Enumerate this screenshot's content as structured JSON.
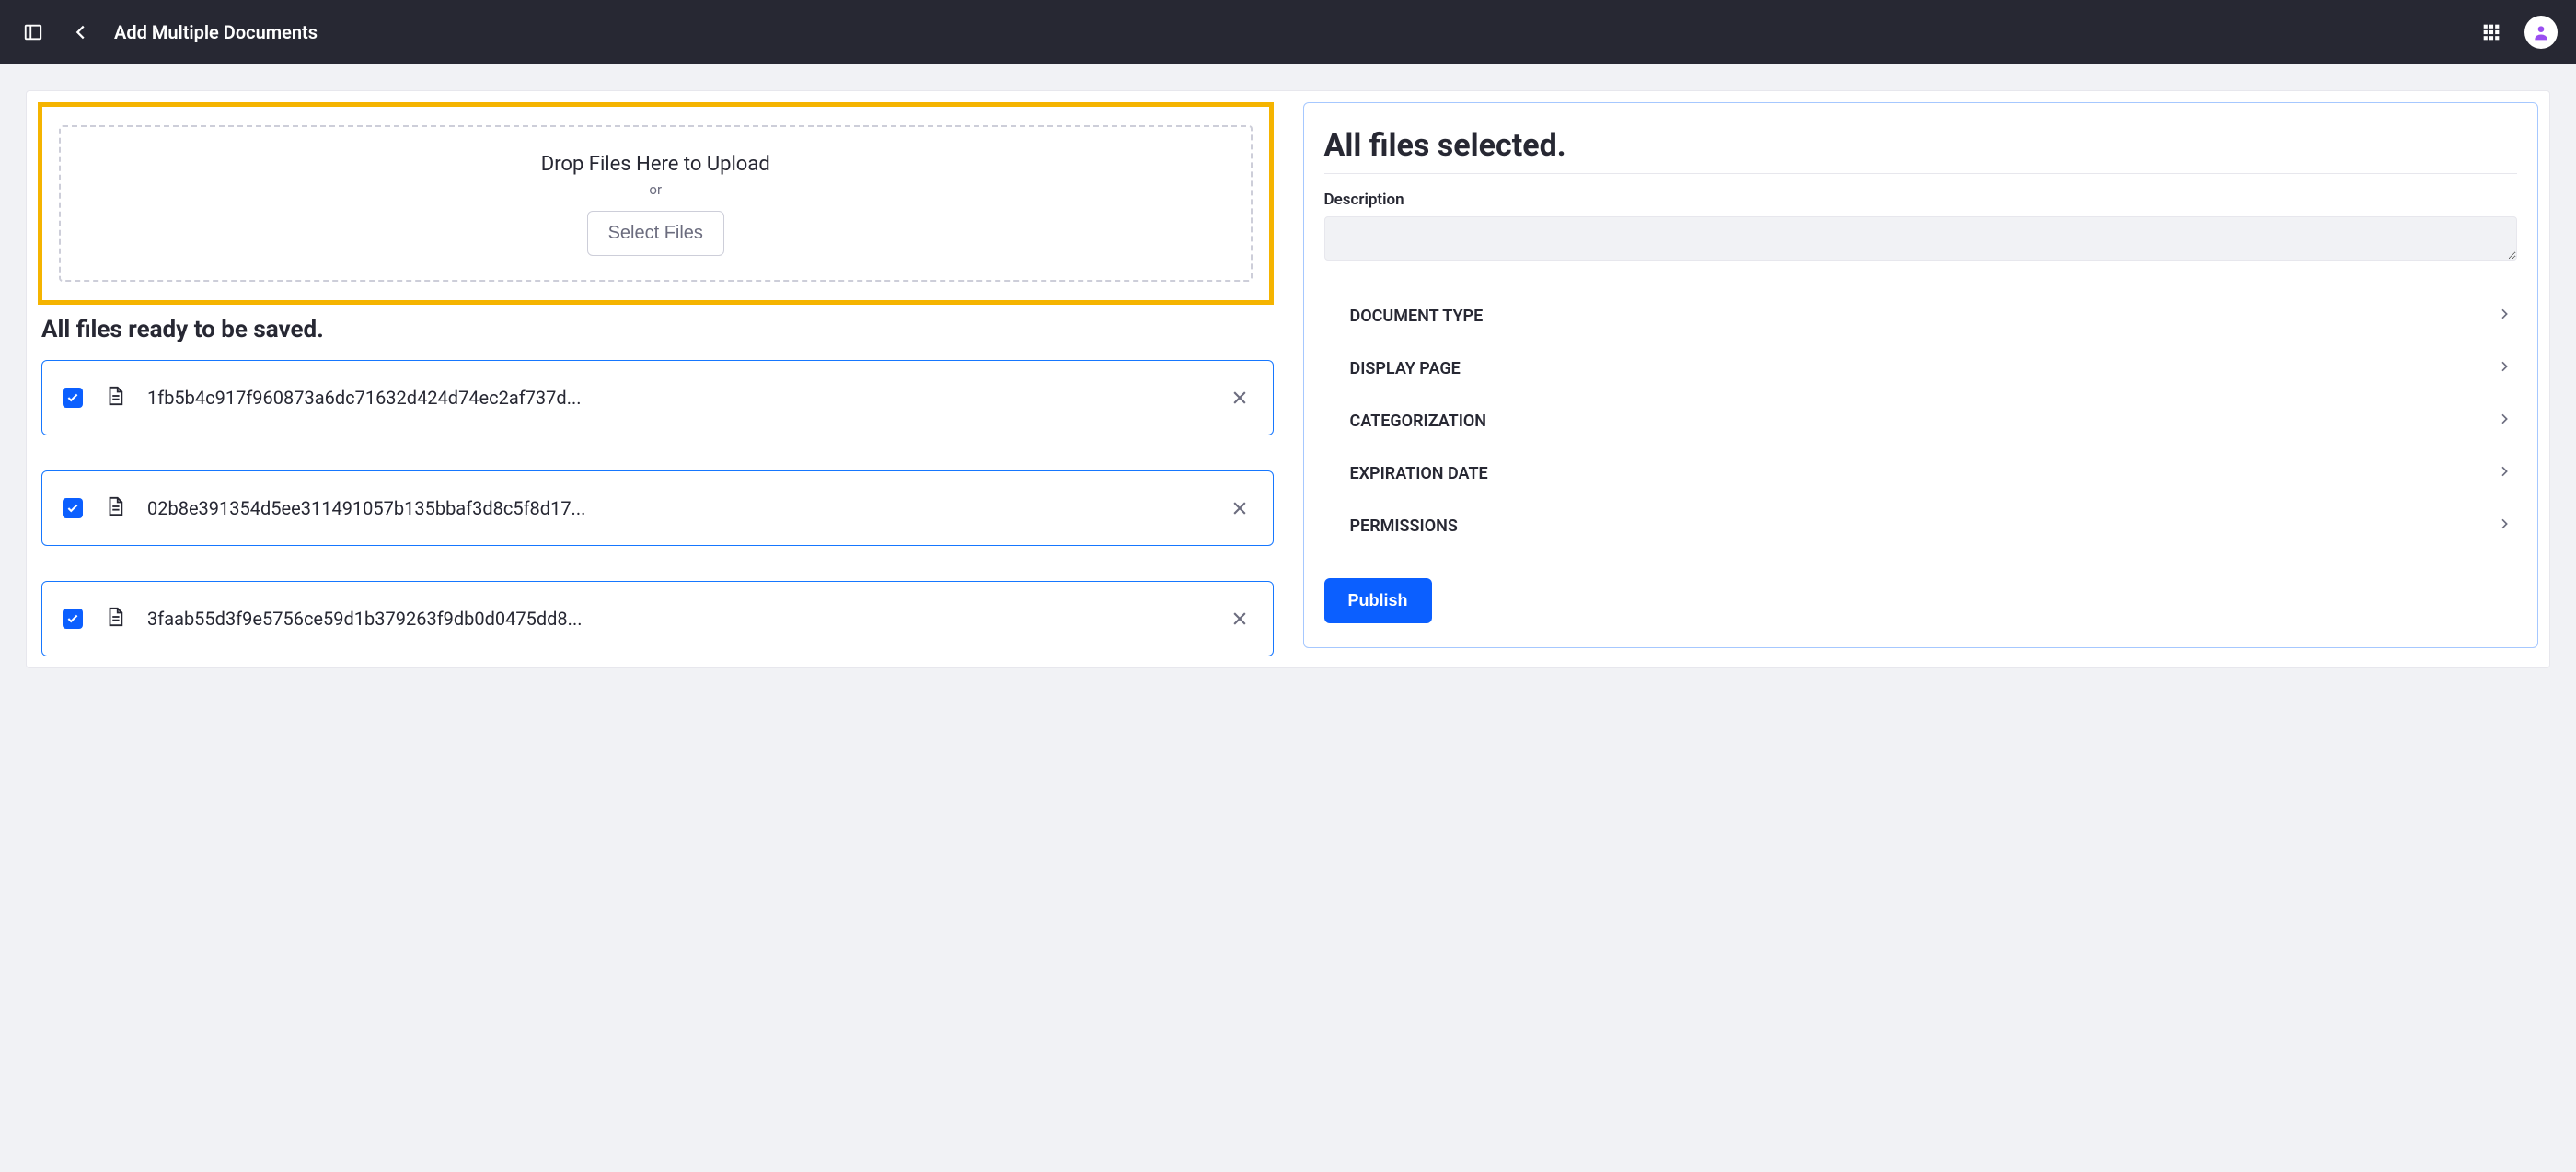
{
  "header": {
    "title": "Add Multiple Documents"
  },
  "dropzone": {
    "title": "Drop Files Here to Upload",
    "or": "or",
    "button": "Select Files"
  },
  "ready_heading": "All files ready to be saved.",
  "files": [
    {
      "name": "1fb5b4c917f960873a6dc71632d424d74ec2af737d..."
    },
    {
      "name": "02b8e391354d5ee311491057b135bbaf3d8c5f8d17..."
    },
    {
      "name": "3faab55d3f9e5756ce59d1b379263f9db0d0475dd8..."
    }
  ],
  "right": {
    "heading": "All files selected.",
    "description_label": "Description",
    "description_value": "",
    "sections": [
      {
        "label": "DOCUMENT TYPE"
      },
      {
        "label": "DISPLAY PAGE"
      },
      {
        "label": "CATEGORIZATION"
      },
      {
        "label": "EXPIRATION DATE"
      },
      {
        "label": "PERMISSIONS"
      }
    ],
    "publish": "Publish"
  }
}
